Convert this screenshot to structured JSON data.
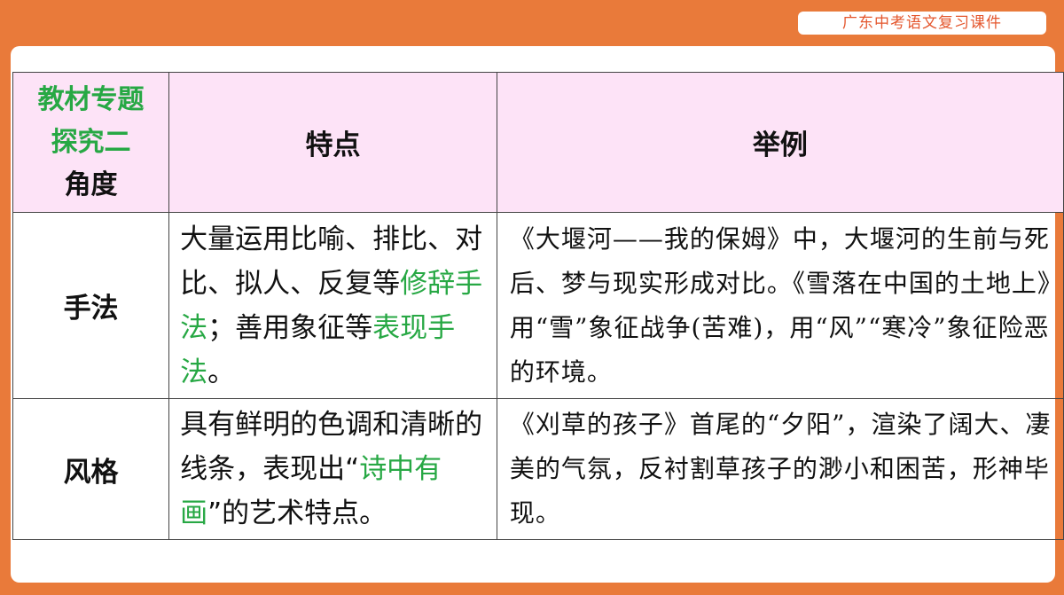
{
  "header": {
    "course_tag": "广东中考语文复习课件"
  },
  "table": {
    "corner": {
      "line1": "教材专题",
      "line2": "探究二",
      "line3": "角度"
    },
    "col_headers": {
      "feature": "特点",
      "example": "举例"
    },
    "rows": [
      {
        "label": "手法",
        "feature_parts": [
          "大量运用比喻、排比、对比、拟人、反复等",
          "修辞手法",
          "；善用象征等",
          "表现手法",
          "。"
        ],
        "example": "《大堰河——我的保姆》中，大堰河的生前与死后、梦与现实形成对比。《雪落在中国的土地上》用“雪”象征战争(苦难)，用“风”“寒冷”象征险恶的环境。"
      },
      {
        "label": "风格",
        "feature_parts": [
          "具有鲜明的色调和清晰的线条，表现出“",
          "诗中有画",
          "”的艺术特点。"
        ],
        "example": "《刈草的孩子》首尾的“夕阳”，渲染了阔大、凄美的气氛，反衬割草孩子的渺小和困苦，形神毕现。"
      }
    ]
  },
  "colors": {
    "accent_orange": "#e97a3a",
    "header_bg": "#fde3f7",
    "highlight_green": "#27a844"
  }
}
